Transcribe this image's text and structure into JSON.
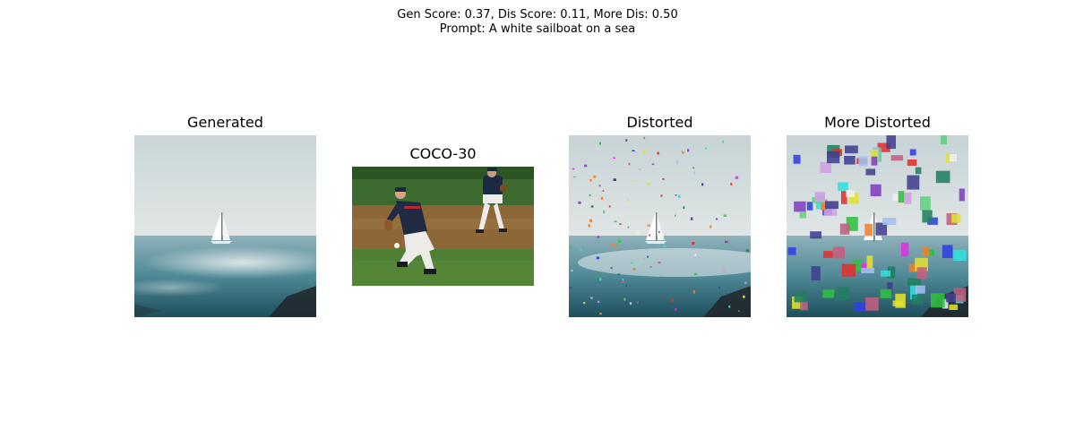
{
  "figure": {
    "line1": "Gen Score: 0.37, Dis Score: 0.11, More Dis: 0.50",
    "line2": "Prompt: A white sailboat on a sea"
  },
  "panels": [
    {
      "title": "Generated",
      "image": "sailboat-on-sea"
    },
    {
      "title": "COCO-30",
      "image": "baseball-players-on-field"
    },
    {
      "title": "Distorted",
      "image": "sailboat-on-sea-with-small-color-squares"
    },
    {
      "title": "More Distorted",
      "image": "sailboat-on-sea-with-large-color-patches"
    }
  ]
}
